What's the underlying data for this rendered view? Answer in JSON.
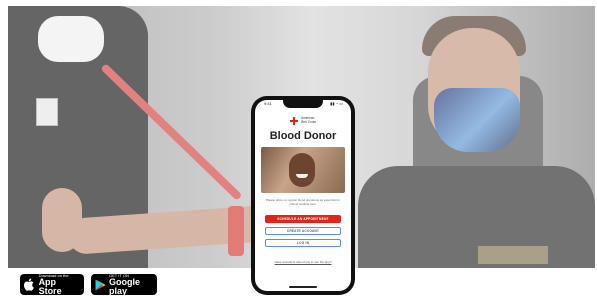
{
  "phone": {
    "status_time": "9:41",
    "status_icons": "▮▮ ◔ ▭",
    "brand_line1": "American",
    "brand_line2": "Red Cross",
    "app_title": "Blood Donor",
    "tagline": "Please allow us regular blood donations as essential for critical medical care.",
    "buttons": {
      "schedule": "SCHEDULE AN APPOINTMENT",
      "create": "CREATE ACCOUNT",
      "login": "LOG IN"
    },
    "footer_link": "Have questions about how to use the app?"
  },
  "stores": {
    "apple_small": "Download on the",
    "apple_big": "App Store",
    "google_small": "GET IT ON",
    "google_big": "Google play"
  },
  "colors": {
    "brand_red": "#e1251b",
    "link_blue": "#2f6aa8"
  }
}
